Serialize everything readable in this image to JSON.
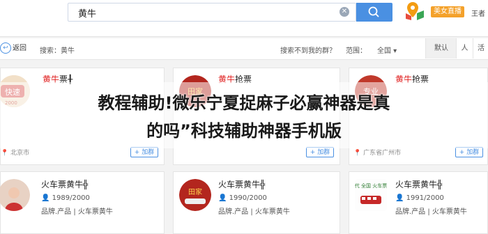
{
  "search": {
    "query": "黄牛",
    "clear_glyph": "✕"
  },
  "header": {
    "live_badge": "美女直播",
    "user": "王者"
  },
  "filter": {
    "back_label": "返回",
    "search_tag": "搜索：黄牛",
    "help_link": "搜索不到我的群？",
    "range_label": "范围：",
    "range_value": "全国 ▾",
    "sort_tabs": [
      "默认",
      "人",
      "活"
    ]
  },
  "cards": [
    {
      "title_kw": "黄牛",
      "title_rest": "票╂",
      "line2": "",
      "line3": "",
      "location": "北京市",
      "add": "加群",
      "avatar_text": "快速",
      "avatar_sub": "2000",
      "avatar_color": "#d9534f"
    },
    {
      "title_kw": "黄牛",
      "title_rest": "抢票",
      "line2": "",
      "line3": "",
      "location": "",
      "add": "加群",
      "avatar_text": "田家",
      "avatar_sub": "",
      "avatar_color": "#b3261e"
    },
    {
      "title_kw": "黄牛",
      "title_rest": "抢票",
      "line2": "专业",
      "line3": "抢票",
      "location": "广东省广州市",
      "add": "加群",
      "avatar_text": "专业",
      "avatar_sub": "",
      "avatar_color": "#c0392b"
    },
    {
      "title_kw": "",
      "title_rest": "火车票黄牛╬",
      "line2": "1989/2000",
      "line3": "品牌.产品 | 火车票黄牛",
      "location": "",
      "add": "",
      "avatar_text": "",
      "avatar_sub": "",
      "avatar_color": "#cc3333"
    },
    {
      "title_kw": "",
      "title_rest": "火车票黄牛╬",
      "line2": "1990/2000",
      "line3": "品牌.产品 | 火车票黄牛",
      "location": "",
      "add": "",
      "avatar_text": "田家",
      "avatar_sub": "",
      "avatar_color": "#b3261e"
    },
    {
      "title_kw": "",
      "title_rest": "火车票黄牛╬",
      "line2": "1991/2000",
      "line3": "品牌.产品 | 火车票黄牛",
      "location": "",
      "add": "",
      "avatar_text": "代 全国 火车票",
      "avatar_sub": "",
      "avatar_color": "#2e7d32"
    }
  ],
  "overlay": {
    "line1": "教程辅助!微乐宁夏捉麻子必赢神器是真",
    "line2": "的吗”科技辅助神器手机版"
  },
  "colors": {
    "accent": "#4a90e2",
    "keyword": "#e02020",
    "badge": "#f4a12a"
  }
}
